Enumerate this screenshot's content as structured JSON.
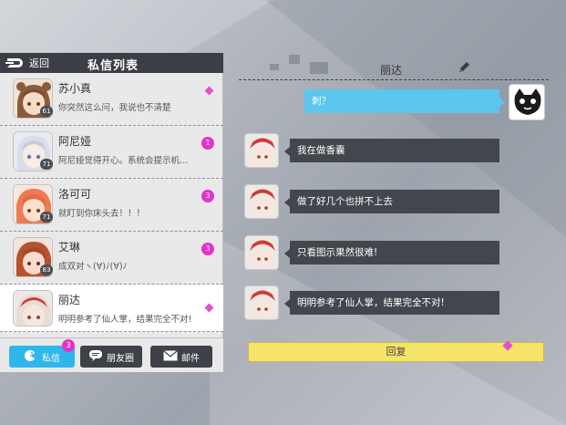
{
  "header": {
    "back_label": "返回",
    "list_title": "私信列表"
  },
  "contacts": [
    {
      "name": "苏小真",
      "message": "你突然这么问，我说也不清楚",
      "level": "61",
      "badge": ""
    },
    {
      "name": "阿尼娅",
      "message": "阿尼娅觉得开心。系统会提示机…",
      "level": "71",
      "badge": "1"
    },
    {
      "name": "洛可可",
      "message": "就盯到你床头去！！！",
      "level": "71",
      "badge": "3"
    },
    {
      "name": "艾琳",
      "message": "成双对ヽ(∀)ﾉ(∀)ﾉ",
      "level": "83",
      "badge": "3"
    },
    {
      "name": "丽达",
      "message": "明明参考了仙人掌，结果完全不对!",
      "level": "",
      "badge": ""
    }
  ],
  "tabs": {
    "messages_label": "私信",
    "messages_badge": "3",
    "moments_label": "朋友圈",
    "mail_label": "邮件"
  },
  "chat": {
    "title": "丽达",
    "outgoing": "刺？",
    "incoming": [
      "我在做香囊",
      "做了好几个也拼不上去",
      "只看图示果然很难!",
      "明明参考了仙人掌，结果完全不对!"
    ],
    "reply_label": "回复"
  },
  "colors": {
    "accent_blue": "#2fb6ea",
    "badge_pink": "#e632c8",
    "reply_yellow": "#f5e46a",
    "dark_panel": "#3b3e44"
  }
}
